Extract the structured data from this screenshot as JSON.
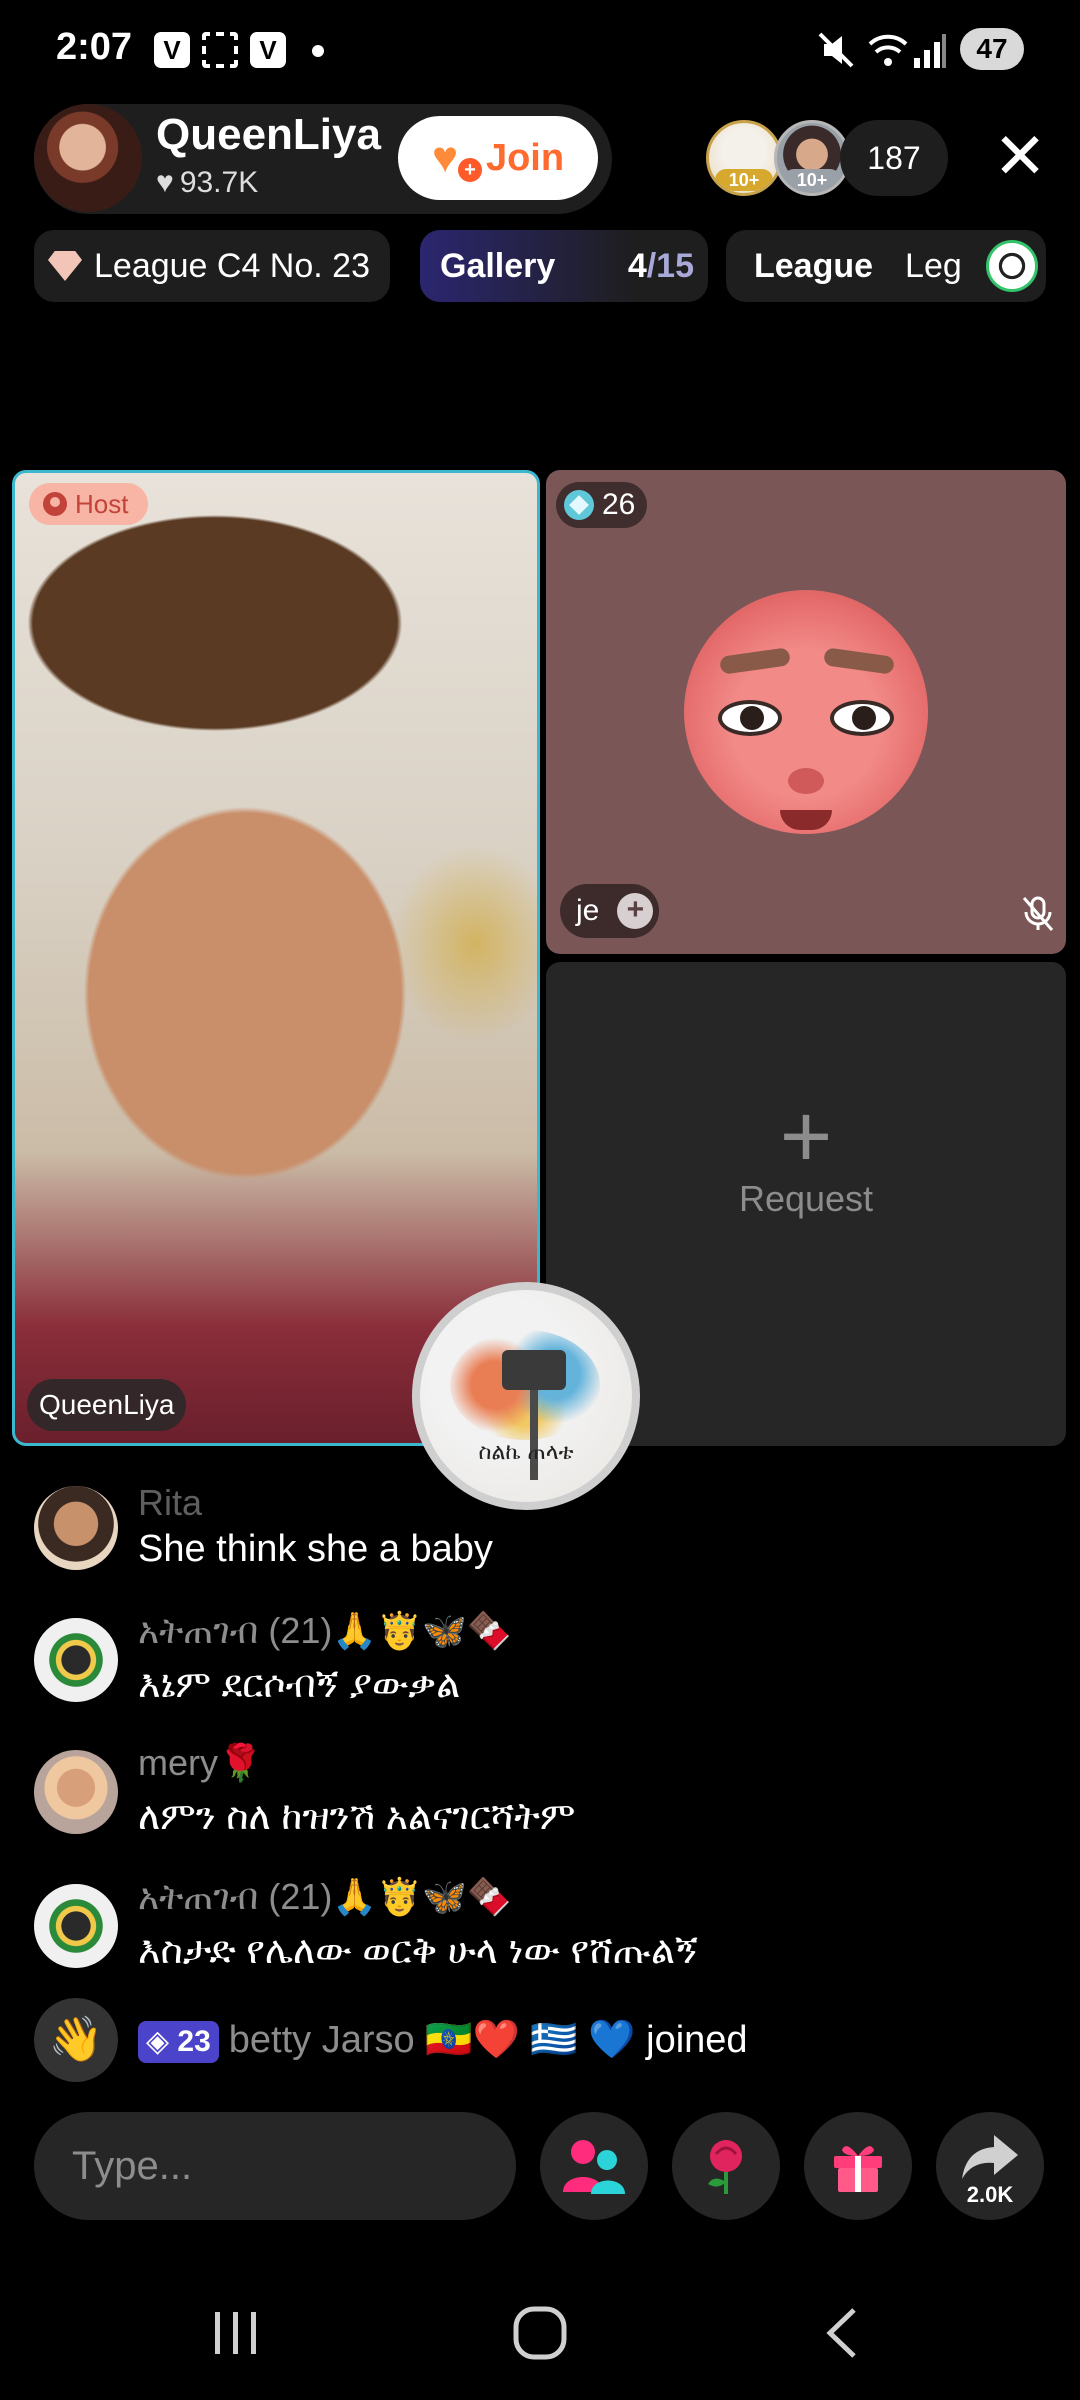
{
  "status_bar": {
    "time": "2:07",
    "battery": "47"
  },
  "header": {
    "host_name": "QueenLiya",
    "host_likes": "93.7K",
    "join_label": "Join",
    "viewer_levels": [
      "10+",
      "10+"
    ],
    "viewer_count": "187"
  },
  "chips": {
    "league": "League C4 No. 23",
    "gallery_label": "Gallery",
    "gallery_current": "4",
    "gallery_total": "/15",
    "league_tab": "League",
    "league_tab_clip": "Leg"
  },
  "tiles": {
    "host_badge": "Host",
    "host_name_tag": "QueenLiya",
    "guest_level": "26",
    "guest_name": "je",
    "request_label": "Request"
  },
  "overlay": {
    "logo_text": "ስልኬ ጠላቴ"
  },
  "chat": [
    {
      "user": "Rita",
      "message": "She think she a baby"
    },
    {
      "user": "አትጠገብ (21)🙏🤴🦋🍫",
      "message": "እኔም ደርሶብኝ ያውቃል"
    },
    {
      "user": "mery🌹",
      "message": "ለምን ስለ ከዝንሽ አልናገርሻትም"
    },
    {
      "user": "አትጠገብ (21)🙏🤴🦋🍫",
      "message": "እስታድ የሌለው ወርቅ ሁላ ነው የሸጡልኝ"
    }
  ],
  "join_notice": {
    "badge": "23",
    "name": "betty Jarso 🇪🇹❤️ 🇬🇷 💙",
    "action": "joined"
  },
  "input": {
    "placeholder": "Type..."
  },
  "share": {
    "count": "2.0K"
  },
  "colors": {
    "accent_join": "#ff6a2e",
    "host_border": "#3bb7d0",
    "gallery_bg": "#2b2670",
    "badge_purple": "#4b43c9"
  }
}
